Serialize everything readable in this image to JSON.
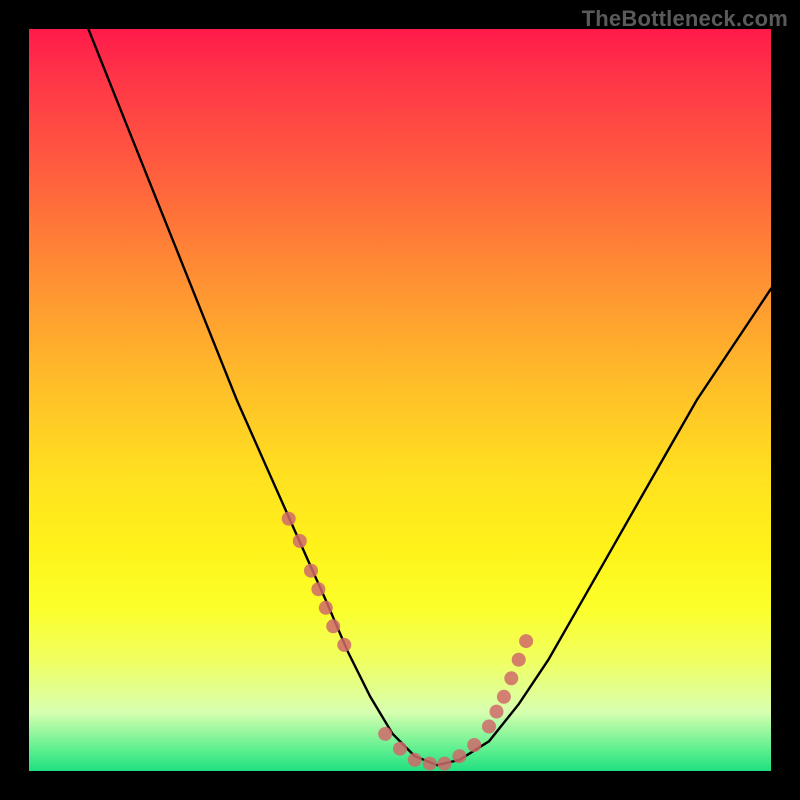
{
  "watermark": "TheBottleneck.com",
  "chart_data": {
    "type": "line",
    "title": "",
    "xlabel": "",
    "ylabel": "",
    "xlim": [
      0,
      100
    ],
    "ylim": [
      0,
      100
    ],
    "series": [
      {
        "name": "bottleneck-curve",
        "x": [
          8,
          12,
          16,
          20,
          24,
          28,
          32,
          36,
          40,
          43,
          46,
          49,
          52,
          55,
          58,
          62,
          66,
          70,
          74,
          78,
          82,
          86,
          90,
          94,
          98,
          100
        ],
        "y": [
          100,
          90,
          80,
          70,
          60,
          50,
          41,
          32,
          23,
          16,
          10,
          5,
          2,
          0.8,
          1.5,
          4,
          9,
          15,
          22,
          29,
          36,
          43,
          50,
          56,
          62,
          65
        ]
      }
    ],
    "markers": {
      "name": "highlight-dots",
      "color": "#cf6a6a",
      "x": [
        35,
        36.5,
        38,
        39,
        40,
        41,
        42.5,
        48,
        50,
        52,
        54,
        56,
        58,
        60,
        62,
        63,
        64,
        65,
        66,
        67
      ],
      "y": [
        34,
        31,
        27,
        24.5,
        22,
        19.5,
        17,
        5,
        3,
        1.5,
        1,
        1,
        2,
        3.5,
        6,
        8,
        10,
        12.5,
        15,
        17.5
      ]
    },
    "gradient_stops": [
      {
        "pos": 0,
        "color": "#ff1a4a"
      },
      {
        "pos": 18,
        "color": "#ff5a3f"
      },
      {
        "pos": 46,
        "color": "#ffb82a"
      },
      {
        "pos": 70,
        "color": "#fff21a"
      },
      {
        "pos": 92,
        "color": "#d8ffb0"
      },
      {
        "pos": 100,
        "color": "#20e080"
      }
    ]
  }
}
